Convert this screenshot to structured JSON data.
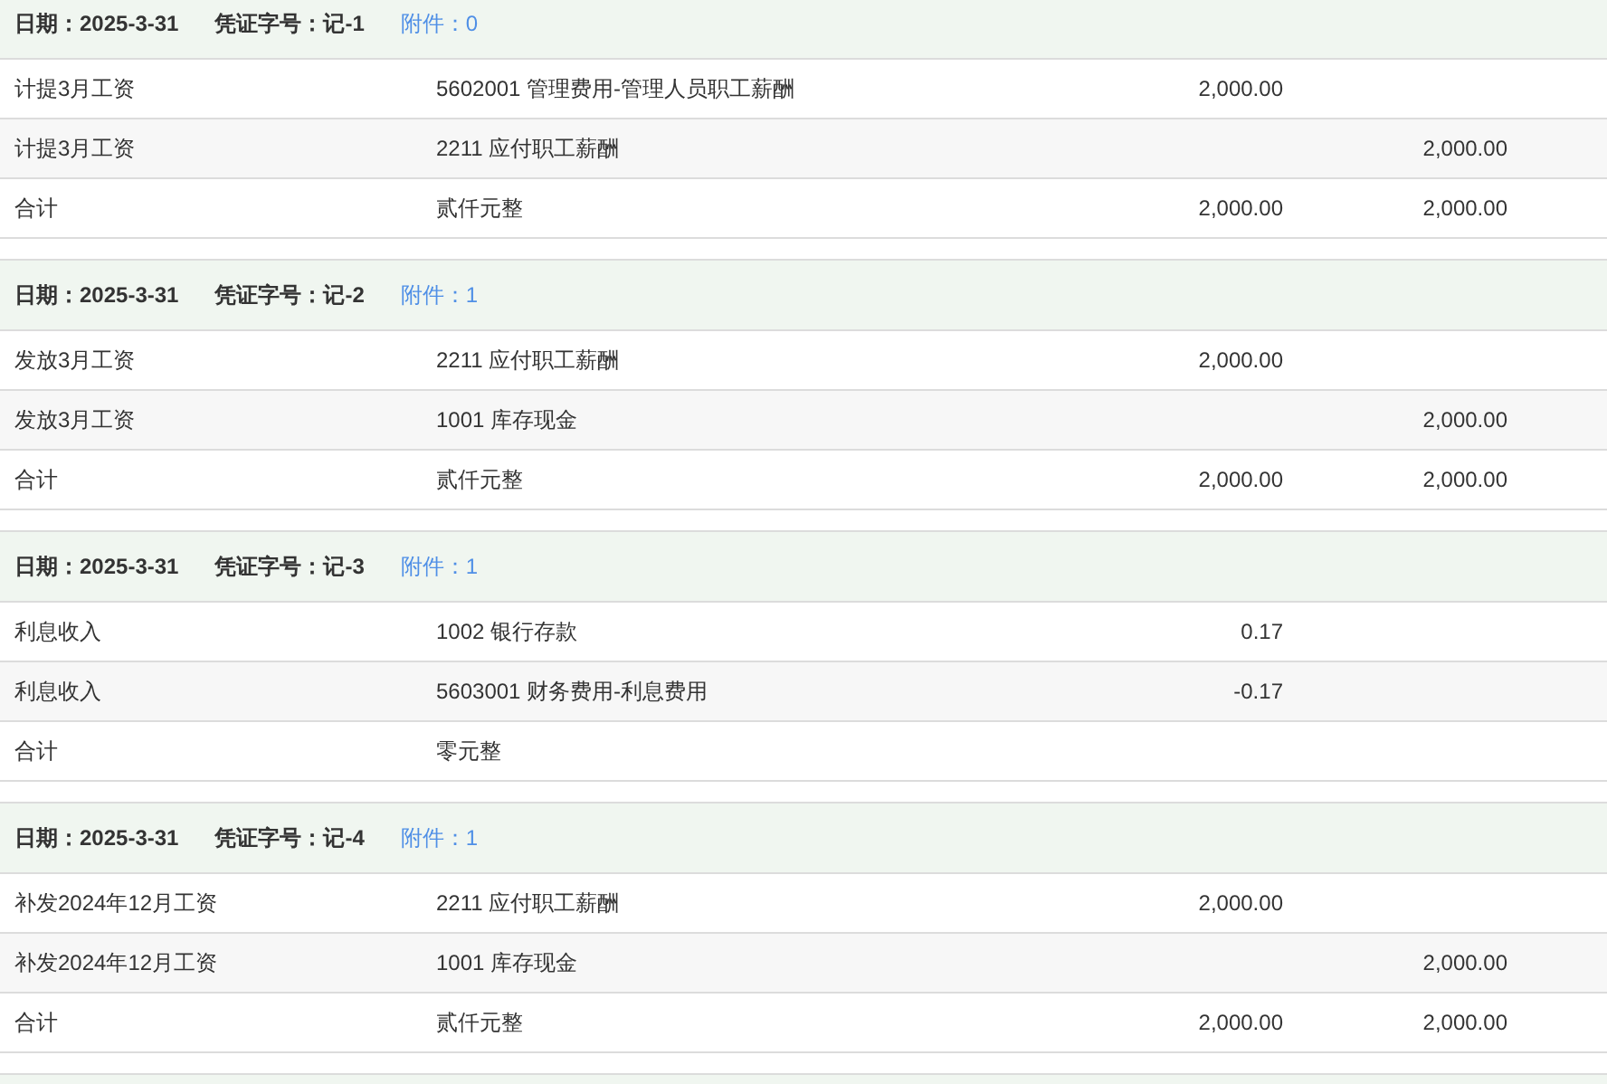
{
  "vouchers": [
    {
      "date": "日期：2025-3-31",
      "number": "凭证字号：记-1",
      "attachments": "附件：0",
      "entries": [
        {
          "summary": "计提3月工资",
          "account": "5602001 管理费用-管理人员职工薪酬",
          "debit": "2,000.00"
        },
        {
          "summary": "计提3月工资",
          "account": "2211 应付职工薪酬",
          "credit": "2,000.00"
        }
      ],
      "total": {
        "label": "合计",
        "amount_words": "贰仟元整",
        "debit": "2,000.00",
        "credit": "2,000.00"
      }
    },
    {
      "date": "日期：2025-3-31",
      "number": "凭证字号：记-2",
      "attachments": "附件：1",
      "entries": [
        {
          "summary": "发放3月工资",
          "account": "2211 应付职工薪酬",
          "debit": "2,000.00"
        },
        {
          "summary": "发放3月工资",
          "account": "1001 库存现金",
          "credit": "2,000.00"
        }
      ],
      "total": {
        "label": "合计",
        "amount_words": "贰仟元整",
        "debit": "2,000.00",
        "credit": "2,000.00"
      }
    },
    {
      "date": "日期：2025-3-31",
      "number": "凭证字号：记-3",
      "attachments": "附件：1",
      "entries": [
        {
          "summary": "利息收入",
          "account": "1002 银行存款",
          "debit": "0.17"
        },
        {
          "summary": "利息收入",
          "account": "5603001 财务费用-利息费用",
          "debit": "-0.17"
        }
      ],
      "total": {
        "label": "合计",
        "amount_words": "零元整"
      }
    },
    {
      "date": "日期：2025-3-31",
      "number": "凭证字号：记-4",
      "attachments": "附件：1",
      "entries": [
        {
          "summary": "补发2024年12月工资",
          "account": "2211 应付职工薪酬",
          "debit": "2,000.00"
        },
        {
          "summary": "补发2024年12月工资",
          "account": "1001 库存现金",
          "credit": "2,000.00"
        }
      ],
      "total": {
        "label": "合计",
        "amount_words": "贰仟元整",
        "debit": "2,000.00",
        "credit": "2,000.00"
      }
    }
  ]
}
